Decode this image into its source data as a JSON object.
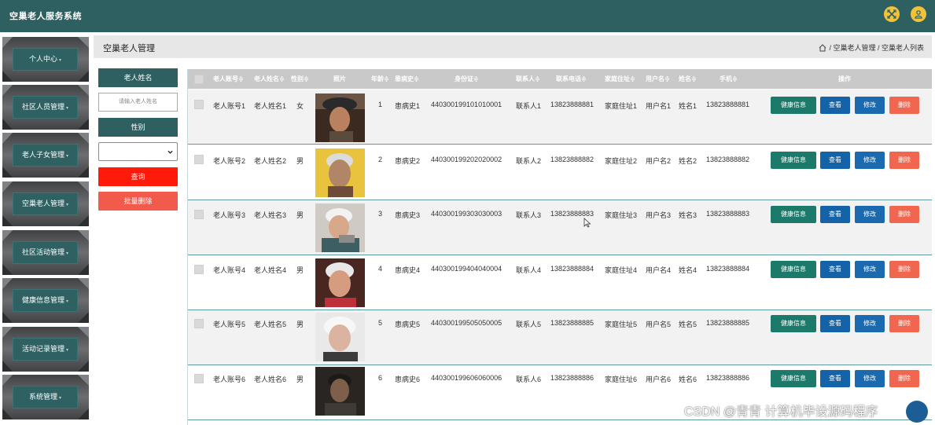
{
  "app": {
    "title": "空巢老人服务系统"
  },
  "header": {
    "icons": [
      "fullscreen-icon",
      "user-icon"
    ],
    "icon_color": "#f2c23a",
    "bar_color": "#2e5f61"
  },
  "sidebar": {
    "items": [
      {
        "label": "个人中心"
      },
      {
        "label": "社区人员管理"
      },
      {
        "label": "老人子女管理"
      },
      {
        "label": "空巢老人管理"
      },
      {
        "label": "社区活动管理"
      },
      {
        "label": "健康信息管理"
      },
      {
        "label": "活动记录管理"
      },
      {
        "label": "系统管理"
      }
    ]
  },
  "breadcrumb": {
    "page_title": "空巢老人管理",
    "trail": "/ 空巢老人管理 / 空巢老人列表"
  },
  "filters": {
    "name_label": "老人姓名",
    "name_placeholder": "请输入老人姓名",
    "gender_label": "性别",
    "gender_value": "",
    "search_button": "查询",
    "batch_delete_button": "批量删除"
  },
  "table": {
    "headers": {
      "account": "老人账号≑",
      "name": "老人姓名≑",
      "gender": "性别≑",
      "photo": "照片",
      "age": "年龄≑",
      "history": "患病史≑",
      "id_card": "身份证≑",
      "contact": "联系人≑",
      "contact_phone": "联系电话≑",
      "address": "家庭住址≑",
      "username": "用户名≑",
      "full_name": "姓名≑",
      "mobile": "手机≑",
      "actions": "操作"
    },
    "action_labels": {
      "health": "健康信息",
      "view": "查看",
      "edit": "修改",
      "delete": "删除"
    },
    "rows": [
      {
        "account": "老人账号1",
        "name": "老人姓名1",
        "gender": "女",
        "age": "1",
        "history": "患病史1",
        "id_card": "440300199101010001",
        "contact": "联系人1",
        "contact_phone": "13823888881",
        "address": "家庭住址1",
        "username": "用户名1",
        "full_name": "姓名1",
        "mobile": "13823888881"
      },
      {
        "account": "老人账号2",
        "name": "老人姓名2",
        "gender": "男",
        "age": "2",
        "history": "患病史2",
        "id_card": "440300199202020002",
        "contact": "联系人2",
        "contact_phone": "13823888882",
        "address": "家庭住址2",
        "username": "用户名2",
        "full_name": "姓名2",
        "mobile": "13823888882"
      },
      {
        "account": "老人账号3",
        "name": "老人姓名3",
        "gender": "男",
        "age": "3",
        "history": "患病史3",
        "id_card": "440300199303030003",
        "contact": "联系人3",
        "contact_phone": "13823888883",
        "address": "家庭住址3",
        "username": "用户名3",
        "full_name": "姓名3",
        "mobile": "13823888883"
      },
      {
        "account": "老人账号4",
        "name": "老人姓名4",
        "gender": "男",
        "age": "4",
        "history": "患病史4",
        "id_card": "440300199404040004",
        "contact": "联系人4",
        "contact_phone": "13823888884",
        "address": "家庭住址4",
        "username": "用户名4",
        "full_name": "姓名4",
        "mobile": "13823888884"
      },
      {
        "account": "老人账号5",
        "name": "老人姓名5",
        "gender": "男",
        "age": "5",
        "history": "患病史5",
        "id_card": "440300199505050005",
        "contact": "联系人5",
        "contact_phone": "13823888885",
        "address": "家庭住址5",
        "username": "用户名5",
        "full_name": "姓名5",
        "mobile": "13823888885"
      },
      {
        "account": "老人账号6",
        "name": "老人姓名6",
        "gender": "男",
        "age": "6",
        "history": "患病史6",
        "id_card": "440300199606060006",
        "contact": "联系人6",
        "contact_phone": "13823888886",
        "address": "家庭住址6",
        "username": "用户名6",
        "full_name": "姓名6",
        "mobile": "13823888886"
      }
    ]
  },
  "watermark": "CSDN @青青  计算机毕设源码程序",
  "colors": {
    "primary": "#2e5f61",
    "search": "#ff1a0a",
    "batch_delete": "#f25a4c",
    "health_btn": "#1c7a6a",
    "view_btn": "#1463a8",
    "delete_btn": "#f0664f"
  }
}
